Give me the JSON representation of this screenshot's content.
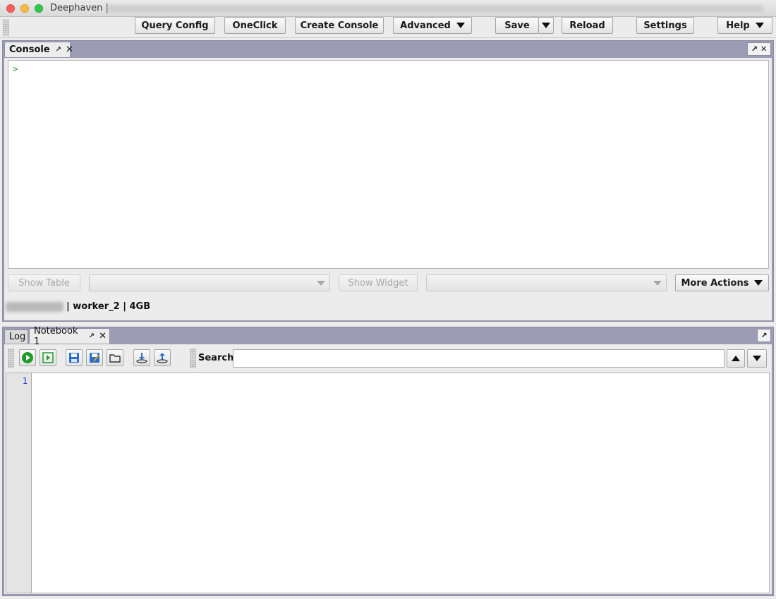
{
  "window": {
    "title": "Deephaven |"
  },
  "toolbar": {
    "query_config": "Query Config",
    "oneclick": "OneClick",
    "create_console": "Create Console",
    "advanced": "Advanced",
    "save": "Save",
    "reload": "Reload",
    "settings": "Settings",
    "help": "Help"
  },
  "console_panel": {
    "tab_label": "Console",
    "prompt": ">",
    "show_table": "Show Table",
    "show_widget": "Show Widget",
    "more_actions": "More Actions",
    "status": "| worker_2 | 4GB"
  },
  "bottom_panel": {
    "tabs": [
      {
        "label": "Log"
      },
      {
        "label": "Notebook 1"
      }
    ],
    "search_label": "Search:",
    "search_value": "",
    "line_numbers": [
      "1"
    ]
  },
  "colors": {
    "panel_frame": "#9c9cb4",
    "prompt_green": "#1a8a1a",
    "line_number_blue": "#1f33d6",
    "icon_green": "#1f9a2a",
    "icon_blue": "#2a6fd0"
  },
  "icons": {
    "pin": "pin-icon",
    "close": "close-icon",
    "run": "run-icon",
    "run_selection": "run-selection-icon",
    "save": "save-file-icon",
    "save_as": "save-as-icon",
    "open": "open-folder-icon",
    "download": "download-icon",
    "upload": "upload-icon"
  }
}
